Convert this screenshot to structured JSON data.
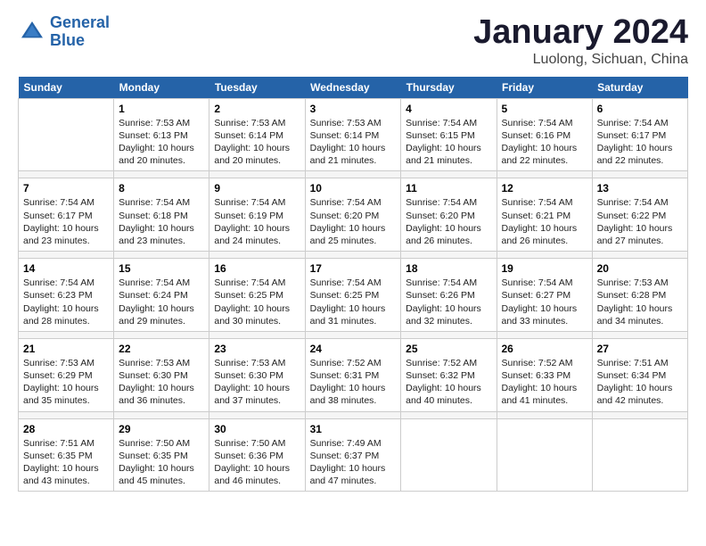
{
  "header": {
    "logo_line1": "General",
    "logo_line2": "Blue",
    "title": "January 2024",
    "subtitle": "Luolong, Sichuan, China"
  },
  "days_of_week": [
    "Sunday",
    "Monday",
    "Tuesday",
    "Wednesday",
    "Thursday",
    "Friday",
    "Saturday"
  ],
  "weeks": [
    [
      {
        "day": "",
        "info": ""
      },
      {
        "day": "1",
        "info": "Sunrise: 7:53 AM\nSunset: 6:13 PM\nDaylight: 10 hours\nand 20 minutes."
      },
      {
        "day": "2",
        "info": "Sunrise: 7:53 AM\nSunset: 6:14 PM\nDaylight: 10 hours\nand 20 minutes."
      },
      {
        "day": "3",
        "info": "Sunrise: 7:53 AM\nSunset: 6:14 PM\nDaylight: 10 hours\nand 21 minutes."
      },
      {
        "day": "4",
        "info": "Sunrise: 7:54 AM\nSunset: 6:15 PM\nDaylight: 10 hours\nand 21 minutes."
      },
      {
        "day": "5",
        "info": "Sunrise: 7:54 AM\nSunset: 6:16 PM\nDaylight: 10 hours\nand 22 minutes."
      },
      {
        "day": "6",
        "info": "Sunrise: 7:54 AM\nSunset: 6:17 PM\nDaylight: 10 hours\nand 22 minutes."
      }
    ],
    [
      {
        "day": "7",
        "info": "Sunrise: 7:54 AM\nSunset: 6:17 PM\nDaylight: 10 hours\nand 23 minutes."
      },
      {
        "day": "8",
        "info": "Sunrise: 7:54 AM\nSunset: 6:18 PM\nDaylight: 10 hours\nand 23 minutes."
      },
      {
        "day": "9",
        "info": "Sunrise: 7:54 AM\nSunset: 6:19 PM\nDaylight: 10 hours\nand 24 minutes."
      },
      {
        "day": "10",
        "info": "Sunrise: 7:54 AM\nSunset: 6:20 PM\nDaylight: 10 hours\nand 25 minutes."
      },
      {
        "day": "11",
        "info": "Sunrise: 7:54 AM\nSunset: 6:20 PM\nDaylight: 10 hours\nand 26 minutes."
      },
      {
        "day": "12",
        "info": "Sunrise: 7:54 AM\nSunset: 6:21 PM\nDaylight: 10 hours\nand 26 minutes."
      },
      {
        "day": "13",
        "info": "Sunrise: 7:54 AM\nSunset: 6:22 PM\nDaylight: 10 hours\nand 27 minutes."
      }
    ],
    [
      {
        "day": "14",
        "info": "Sunrise: 7:54 AM\nSunset: 6:23 PM\nDaylight: 10 hours\nand 28 minutes."
      },
      {
        "day": "15",
        "info": "Sunrise: 7:54 AM\nSunset: 6:24 PM\nDaylight: 10 hours\nand 29 minutes."
      },
      {
        "day": "16",
        "info": "Sunrise: 7:54 AM\nSunset: 6:25 PM\nDaylight: 10 hours\nand 30 minutes."
      },
      {
        "day": "17",
        "info": "Sunrise: 7:54 AM\nSunset: 6:25 PM\nDaylight: 10 hours\nand 31 minutes."
      },
      {
        "day": "18",
        "info": "Sunrise: 7:54 AM\nSunset: 6:26 PM\nDaylight: 10 hours\nand 32 minutes."
      },
      {
        "day": "19",
        "info": "Sunrise: 7:54 AM\nSunset: 6:27 PM\nDaylight: 10 hours\nand 33 minutes."
      },
      {
        "day": "20",
        "info": "Sunrise: 7:53 AM\nSunset: 6:28 PM\nDaylight: 10 hours\nand 34 minutes."
      }
    ],
    [
      {
        "day": "21",
        "info": "Sunrise: 7:53 AM\nSunset: 6:29 PM\nDaylight: 10 hours\nand 35 minutes."
      },
      {
        "day": "22",
        "info": "Sunrise: 7:53 AM\nSunset: 6:30 PM\nDaylight: 10 hours\nand 36 minutes."
      },
      {
        "day": "23",
        "info": "Sunrise: 7:53 AM\nSunset: 6:30 PM\nDaylight: 10 hours\nand 37 minutes."
      },
      {
        "day": "24",
        "info": "Sunrise: 7:52 AM\nSunset: 6:31 PM\nDaylight: 10 hours\nand 38 minutes."
      },
      {
        "day": "25",
        "info": "Sunrise: 7:52 AM\nSunset: 6:32 PM\nDaylight: 10 hours\nand 40 minutes."
      },
      {
        "day": "26",
        "info": "Sunrise: 7:52 AM\nSunset: 6:33 PM\nDaylight: 10 hours\nand 41 minutes."
      },
      {
        "day": "27",
        "info": "Sunrise: 7:51 AM\nSunset: 6:34 PM\nDaylight: 10 hours\nand 42 minutes."
      }
    ],
    [
      {
        "day": "28",
        "info": "Sunrise: 7:51 AM\nSunset: 6:35 PM\nDaylight: 10 hours\nand 43 minutes."
      },
      {
        "day": "29",
        "info": "Sunrise: 7:50 AM\nSunset: 6:35 PM\nDaylight: 10 hours\nand 45 minutes."
      },
      {
        "day": "30",
        "info": "Sunrise: 7:50 AM\nSunset: 6:36 PM\nDaylight: 10 hours\nand 46 minutes."
      },
      {
        "day": "31",
        "info": "Sunrise: 7:49 AM\nSunset: 6:37 PM\nDaylight: 10 hours\nand 47 minutes."
      },
      {
        "day": "",
        "info": ""
      },
      {
        "day": "",
        "info": ""
      },
      {
        "day": "",
        "info": ""
      }
    ]
  ]
}
